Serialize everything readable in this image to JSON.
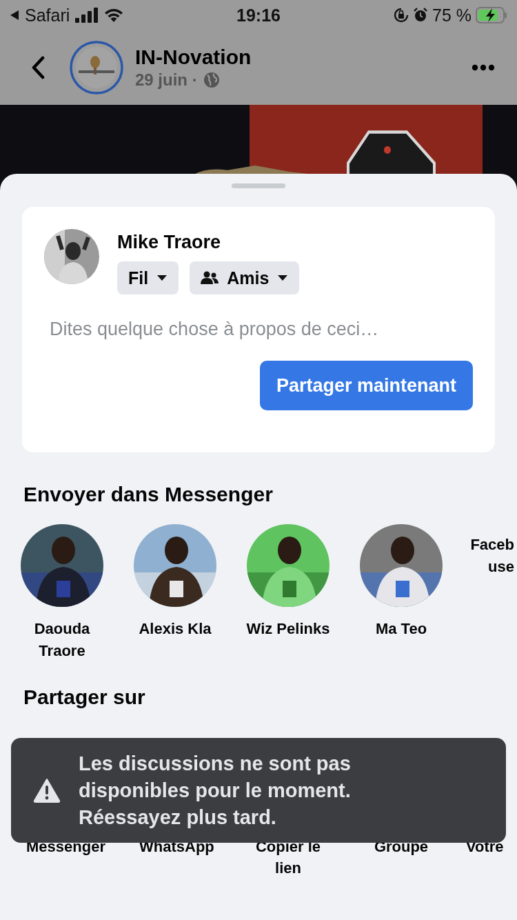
{
  "status_bar": {
    "back_app": "Safari",
    "time": "19:16",
    "battery": "75 %"
  },
  "post_header": {
    "page_name": "IN-Novation",
    "date": "29 juin ·"
  },
  "share_card": {
    "user_name": "Mike Traore",
    "audience_chips": [
      {
        "label": "Fil",
        "kind": "feed"
      },
      {
        "label": "Amis",
        "kind": "friends"
      }
    ],
    "placeholder": "Dites quelque chose à propos de ceci…",
    "button": "Partager maintenant"
  },
  "messenger": {
    "title": "Envoyer dans Messenger",
    "contacts": [
      {
        "name": "Daouda Traore"
      },
      {
        "name": "Alexis Kla"
      },
      {
        "name": "Wiz Pelinks"
      },
      {
        "name": "Ma Teo"
      },
      {
        "name": "Faceb use"
      }
    ]
  },
  "share_on": {
    "title": "Partager sur",
    "targets": [
      {
        "label": "Messenger"
      },
      {
        "label": "WhatsApp"
      },
      {
        "label": "Copier le lien"
      },
      {
        "label": "Groupe"
      },
      {
        "label": "Votre"
      }
    ]
  },
  "toast": {
    "message": "Les discussions ne sont pas disponibles pour le moment. Réessayez plus tard."
  }
}
